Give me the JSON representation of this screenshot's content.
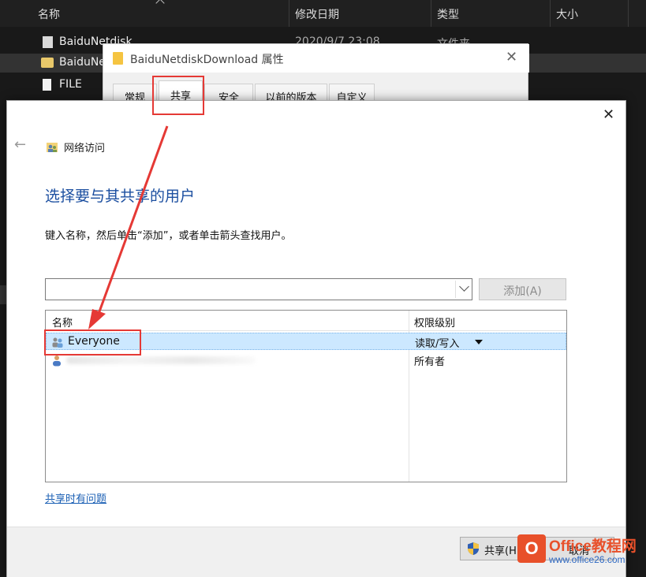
{
  "explorer": {
    "columns": [
      "名称",
      "修改日期",
      "类型",
      "大小"
    ],
    "rows": [
      {
        "name": "BaiduNetdisk",
        "date": "2020/9/7 23:08",
        "type": "文件夹"
      },
      {
        "name": "BaiduNe",
        "date": "",
        "type": ""
      },
      {
        "name": "FILE",
        "date": "",
        "type": ""
      }
    ]
  },
  "properties": {
    "title": "BaiduNetdiskDownload 属性",
    "tabs": [
      "常规",
      "共享",
      "安全",
      "以前的版本",
      "自定义"
    ]
  },
  "dialog": {
    "nav_title": "网络访问",
    "heading": "选择要与其共享的用户",
    "instruction": "键入名称，然后单击“添加”，或者单击箭头查找用户。",
    "add_button": "添加(A)",
    "columns": {
      "name": "名称",
      "permission": "权限级别"
    },
    "rows": [
      {
        "name": "Everyone",
        "permission": "读取/写入"
      },
      {
        "name": "",
        "permission": "所有者"
      }
    ],
    "help_link": "共享时有问题",
    "share_button": "共享(H)",
    "cancel_button": "取消"
  },
  "colors": {
    "accent": "#1c4fa0",
    "annotation": "#e53935",
    "selection": "#cce8ff"
  },
  "watermark": {
    "logo": "O",
    "brand": "Office教程网",
    "url": "www.office26.com"
  }
}
